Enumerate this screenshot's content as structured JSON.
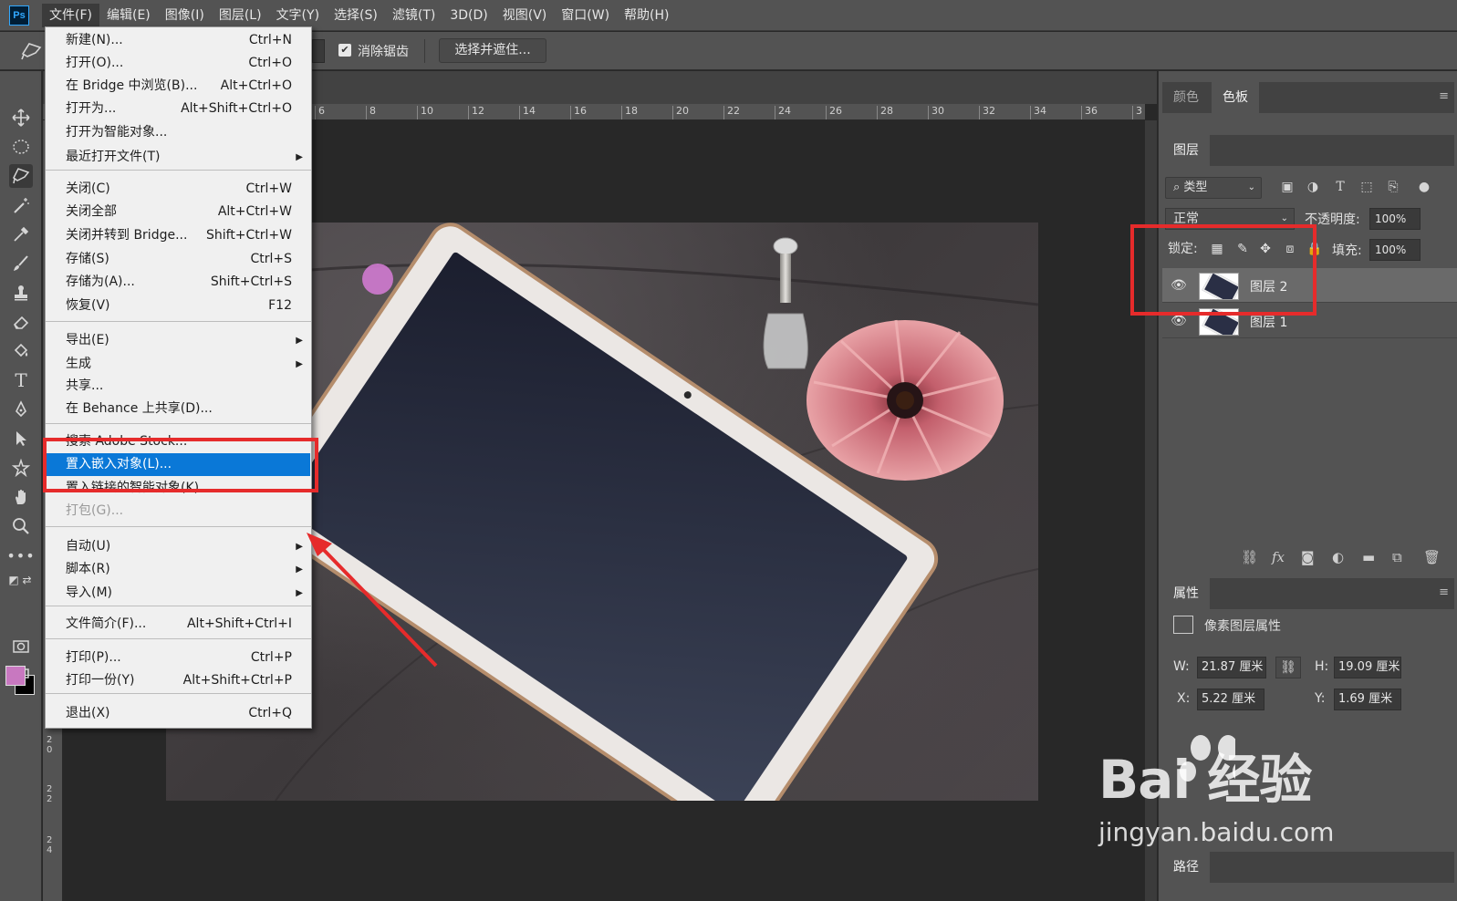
{
  "app": {
    "logo": "Ps",
    "menubar": [
      "文件(F)",
      "编辑(E)",
      "图像(I)",
      "图层(L)",
      "文字(Y)",
      "选择(S)",
      "滤镜(T)",
      "3D(D)",
      "视图(V)",
      "窗口(W)",
      "帮助(H)"
    ],
    "active_menu_index": 0
  },
  "options_bar": {
    "antialias_label": "消除锯齿",
    "antialias_checked": true,
    "select_mask_button": "选择并遮住..."
  },
  "tools": [
    "move-icon",
    "marquee-ellipse-icon",
    "polygonal-lasso-icon",
    "magic-wand-icon",
    "eyedropper-icon",
    "brush-icon",
    "stamp-icon",
    "eraser-icon",
    "paint-bucket-icon",
    "type-icon",
    "pen-icon",
    "path-select-icon",
    "custom-shape-icon",
    "hand-icon",
    "zoom-icon",
    "more-tools-icon"
  ],
  "colors": {
    "foreground": "#c878c0",
    "background": "#000000",
    "highlight": "#0a78d7",
    "annotation_red": "#e62b2b"
  },
  "ruler": {
    "top": [
      "6",
      "8",
      "10",
      "12",
      "14",
      "16",
      "18",
      "20",
      "22",
      "24",
      "26",
      "28",
      "30",
      "32",
      "34",
      "36",
      "3"
    ],
    "left": [
      "2\n0",
      "2\n2",
      "2\n4"
    ]
  },
  "file_menu": {
    "items": [
      {
        "label": "新建(N)...",
        "shortcut": "Ctrl+N"
      },
      {
        "label": "打开(O)...",
        "shortcut": "Ctrl+O"
      },
      {
        "label": "在 Bridge 中浏览(B)...",
        "shortcut": "Alt+Ctrl+O"
      },
      {
        "label": "打开为...",
        "shortcut": "Alt+Shift+Ctrl+O"
      },
      {
        "label": "打开为智能对象...",
        "shortcut": ""
      },
      {
        "label": "最近打开文件(T)",
        "shortcut": "",
        "submenu": true
      },
      {
        "label": "关闭(C)",
        "shortcut": "Ctrl+W"
      },
      {
        "label": "关闭全部",
        "shortcut": "Alt+Ctrl+W"
      },
      {
        "label": "关闭并转到 Bridge...",
        "shortcut": "Shift+Ctrl+W"
      },
      {
        "label": "存储(S)",
        "shortcut": "Ctrl+S"
      },
      {
        "label": "存储为(A)...",
        "shortcut": "Shift+Ctrl+S"
      },
      {
        "label": "恢复(V)",
        "shortcut": "F12"
      },
      {
        "label": "导出(E)",
        "shortcut": "",
        "submenu": true
      },
      {
        "label": "生成",
        "shortcut": "",
        "submenu": true
      },
      {
        "label": "共享...",
        "shortcut": ""
      },
      {
        "label": "在 Behance 上共享(D)...",
        "shortcut": ""
      },
      {
        "label": "搜索 Adobe Stock...",
        "shortcut": ""
      },
      {
        "label": "置入嵌入对象(L)...",
        "shortcut": "",
        "highlighted": true
      },
      {
        "label": "置入链接的智能对象(K)...",
        "shortcut": ""
      },
      {
        "label": "打包(G)...",
        "shortcut": "",
        "disabled": true
      },
      {
        "label": "自动(U)",
        "shortcut": "",
        "submenu": true
      },
      {
        "label": "脚本(R)",
        "shortcut": "",
        "submenu": true
      },
      {
        "label": "导入(M)",
        "shortcut": "",
        "submenu": true
      },
      {
        "label": "文件简介(F)...",
        "shortcut": "Alt+Shift+Ctrl+I"
      },
      {
        "label": "打印(P)...",
        "shortcut": "Ctrl+P"
      },
      {
        "label": "打印一份(Y)",
        "shortcut": "Alt+Shift+Ctrl+P"
      },
      {
        "label": "退出(X)",
        "shortcut": "Ctrl+Q"
      }
    ]
  },
  "right_dock": {
    "top_tabs": [
      "颜色",
      "色板"
    ],
    "selected_top_tab": 1,
    "layers_tab": "图层",
    "filter_kind": "类型",
    "blend_mode": "正常",
    "opacity_label": "不透明度:",
    "opacity_value": "100%",
    "lock_label": "锁定:",
    "fill_label": "填充:",
    "fill_value": "100%",
    "layers": [
      {
        "name": "图层 2",
        "selected": true
      },
      {
        "name": "图层 1",
        "selected": false
      }
    ],
    "properties_tab": "属性",
    "properties_type": "像素图层属性",
    "props": {
      "w_label": "W:",
      "w_value": "21.87 厘米",
      "h_label": "H:",
      "h_value": "19.09 厘米",
      "x_label": "X:",
      "x_value": "5.22 厘米",
      "y_label": "Y:",
      "y_value": "1.69 厘米"
    },
    "paths_tab": "路径"
  },
  "watermark": {
    "brand": "Bai  经验",
    "url": "jingyan.baidu.com"
  }
}
